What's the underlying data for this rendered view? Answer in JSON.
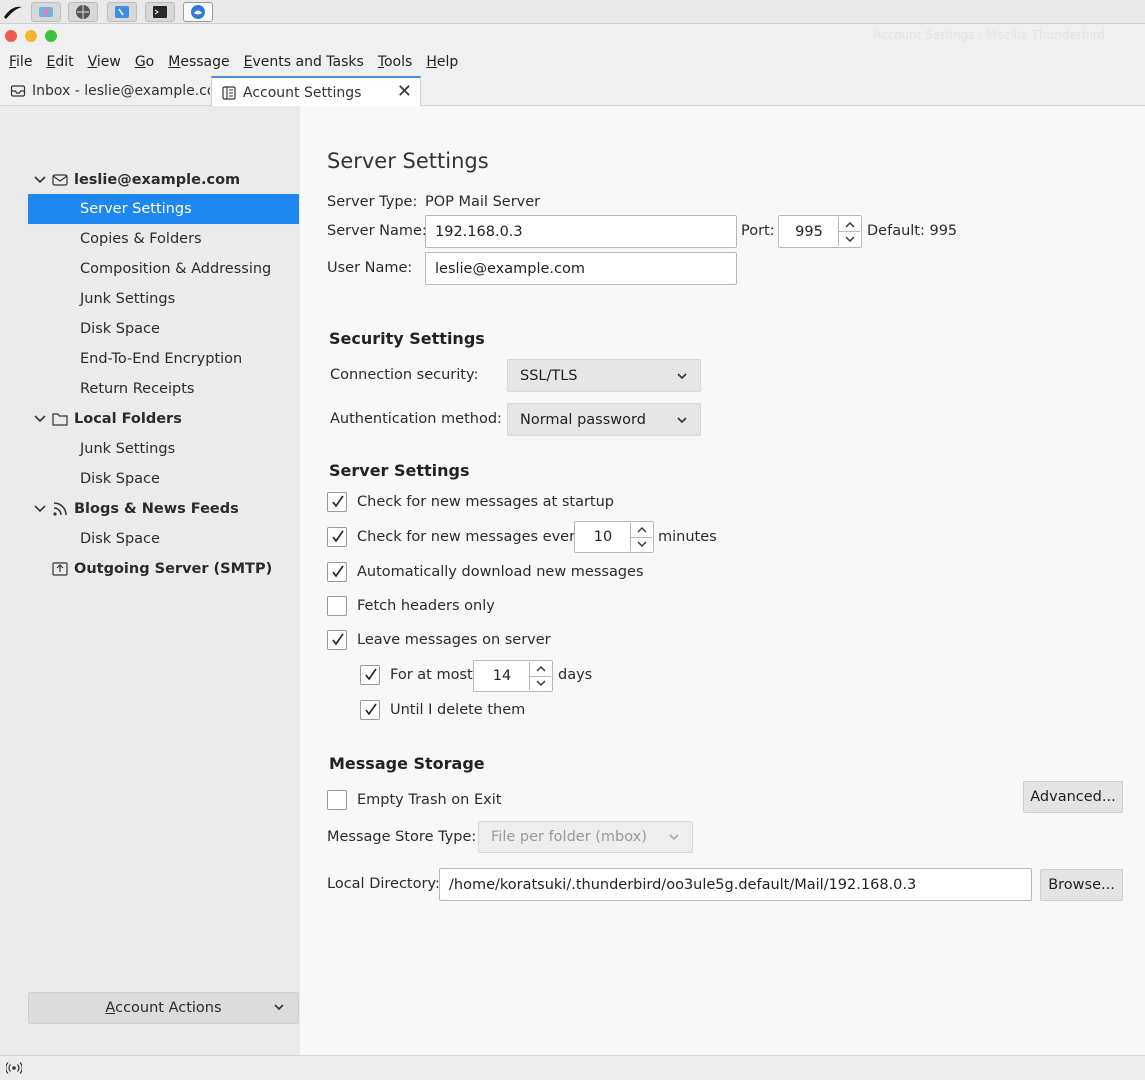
{
  "window": {
    "title": "Account Settings - Mozilla Thunderbird"
  },
  "menubar": [
    "File",
    "Edit",
    "View",
    "Go",
    "Message",
    "Events and Tasks",
    "Tools",
    "Help"
  ],
  "tabs": [
    {
      "label": "Inbox - leslie@example.com",
      "icon": "mail-icon"
    },
    {
      "label": "Account Settings",
      "icon": "settings-page-icon"
    }
  ],
  "sidebar": {
    "account": {
      "label": "leslie@example.com",
      "children": [
        "Server Settings",
        "Copies & Folders",
        "Composition & Addressing",
        "Junk Settings",
        "Disk Space",
        "End-To-End Encryption",
        "Return Receipts"
      ]
    },
    "local_folders": {
      "label": "Local Folders",
      "children": [
        "Junk Settings",
        "Disk Space"
      ]
    },
    "feeds": {
      "label": "Blogs & News Feeds",
      "children": [
        "Disk Space"
      ]
    },
    "smtp": {
      "label": "Outgoing Server (SMTP)"
    },
    "account_actions": "Account Actions"
  },
  "main": {
    "title": "Server Settings",
    "server_type_label": "Server Type:",
    "server_type_value": "POP Mail Server",
    "server_name_label": "Server Name:",
    "server_name_value": "192.168.0.3",
    "port_label": "Port:",
    "port_value": "995",
    "default_port": "Default: 995",
    "user_name_label": "User Name:",
    "user_name_value": "leslie@example.com",
    "security_heading": "Security Settings",
    "connection_security_label": "Connection security:",
    "connection_security_value": "SSL/TLS",
    "auth_method_label": "Authentication method:",
    "auth_method_value": "Normal password",
    "server_settings_heading": "Server Settings",
    "check_startup": {
      "label": "Check for new messages at startup",
      "checked": true
    },
    "check_every": {
      "label": "Check for new messages every",
      "value": "10",
      "suffix": "minutes",
      "checked": true
    },
    "auto_download": {
      "label": "Automatically download new messages",
      "checked": true
    },
    "fetch_headers": {
      "label": "Fetch headers only",
      "checked": false
    },
    "leave_on_server": {
      "label": "Leave messages on server",
      "checked": true
    },
    "for_at_most": {
      "label": "For at most",
      "value": "14",
      "suffix": "days",
      "checked": true
    },
    "until_delete": {
      "label": "Until I delete them",
      "checked": true
    },
    "storage_heading": "Message Storage",
    "empty_trash": {
      "label": "Empty Trash on Exit",
      "checked": false
    },
    "advanced_button": "Advanced...",
    "store_type_label": "Message Store Type:",
    "store_type_value": "File per folder (mbox)",
    "local_dir_label": "Local Directory:",
    "local_dir_value": "/home/koratsuki/.thunderbird/oo3ule5g.default/Mail/192.168.0.3",
    "browse_button": "Browse..."
  },
  "colors": {
    "selection": "#1e88f0",
    "accent_tab": "#4a90d9"
  }
}
